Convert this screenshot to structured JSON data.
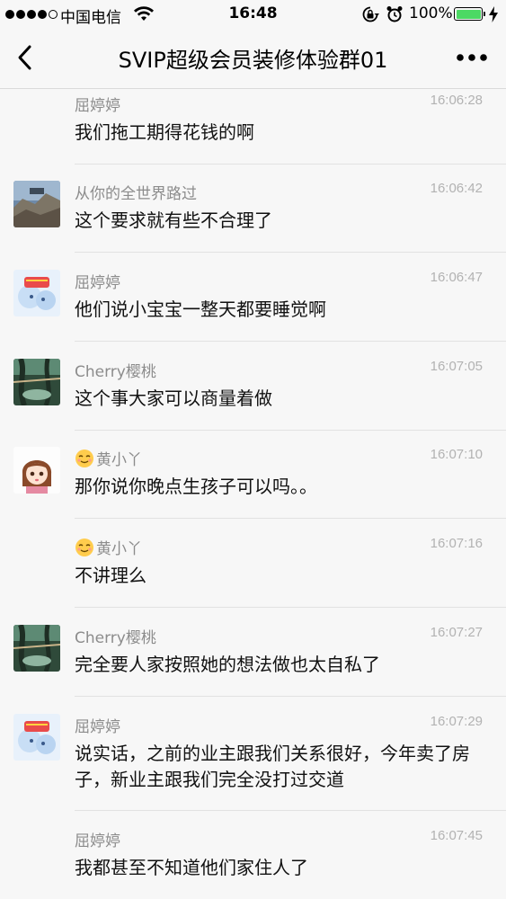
{
  "status_bar": {
    "carrier": "中国电信",
    "time": "16:48",
    "battery": "100%",
    "icons": [
      "signal-dots",
      "wifi-icon",
      "rotation-lock-icon",
      "alarm-icon",
      "battery-icon",
      "charging-icon"
    ]
  },
  "nav": {
    "title": "SVIP超级会员装修体验群01",
    "back_icon": "chevron-left-icon",
    "more_icon": "more-dots-icon"
  },
  "messages": [
    {
      "name": "屈婷婷",
      "time": "16:06:28",
      "text": "我们拖工期得花钱的啊",
      "avatar": "none"
    },
    {
      "name": "从你的全世界路过",
      "time": "16:06:42",
      "text": "这个要求就有些不合理了",
      "avatar": "landscape"
    },
    {
      "name": "屈婷婷",
      "time": "16:06:47",
      "text": "他们说小宝宝一整天都要睡觉啊",
      "avatar": "cartoon"
    },
    {
      "name": "Cherry樱桃",
      "time": "16:07:05",
      "text": "这个事大家可以商量着做",
      "avatar": "forest"
    },
    {
      "name": "黄小丫",
      "time": "16:07:10",
      "text": "那你说你晚点生孩子可以吗。。",
      "avatar": "girl"
    },
    {
      "name": "黄小丫",
      "time": "16:07:16",
      "text": "不讲理么",
      "avatar": "none"
    },
    {
      "name": "Cherry樱桃",
      "time": "16:07:27",
      "text": "完全要人家按照她的想法做也太自私了",
      "avatar": "forest"
    },
    {
      "name": "屈婷婷",
      "time": "16:07:29",
      "text": "说实话，之前的业主跟我们关系很好，今年卖了房子，新业主跟我们完全没打过交道",
      "avatar": "cartoon"
    },
    {
      "name": "屈婷婷",
      "time": "16:07:45",
      "text": "我都甚至不知道他们家住人了",
      "avatar": "none"
    }
  ],
  "colors": {
    "background": "#f7f7f7",
    "name": "#8c8c8c",
    "time": "#b2b2b2",
    "battery": "#4cd964"
  }
}
